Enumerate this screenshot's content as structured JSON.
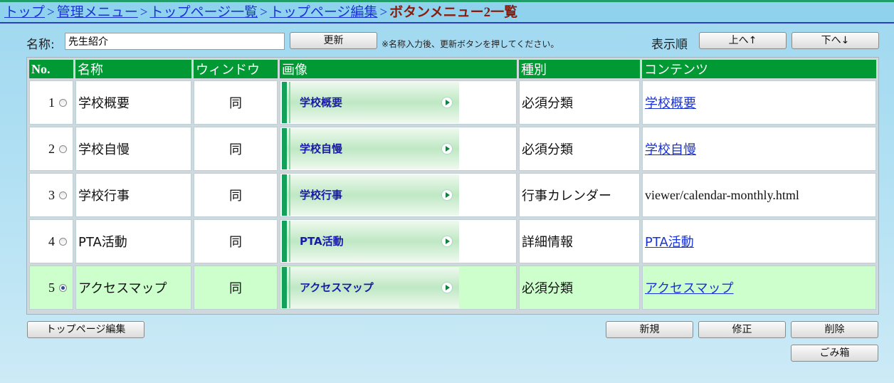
{
  "breadcrumb": {
    "items": [
      "トップ",
      "管理メニュー",
      "トップページ一覧",
      "トップページ編集"
    ],
    "separator": ">",
    "current": "ボタンメニュー2一覧"
  },
  "form": {
    "name_label": "名称:",
    "name_value": "先生紹介",
    "update_label": "更新",
    "note": "※名称入力後、更新ボタンを押してください。",
    "order_label": "表示順",
    "up_label": "上へ↑",
    "down_label": "下へ↓"
  },
  "table": {
    "headers": [
      "No.",
      "名称",
      "ウィンドウ",
      "画像",
      "種別",
      "コンテンツ"
    ],
    "rows": [
      {
        "no": "1",
        "name": "学校概要",
        "window": "同",
        "image_text": "学校概要",
        "type": "必須分類",
        "content": "学校概要",
        "link": true,
        "selected": false
      },
      {
        "no": "2",
        "name": "学校自慢",
        "window": "同",
        "image_text": "学校自慢",
        "type": "必須分類",
        "content": "学校自慢",
        "link": true,
        "selected": false
      },
      {
        "no": "3",
        "name": "学校行事",
        "window": "同",
        "image_text": "学校行事",
        "type": "行事カレンダー",
        "content": "viewer/calendar-monthly.html",
        "link": false,
        "selected": false
      },
      {
        "no": "4",
        "name": "PTA活動",
        "window": "同",
        "image_text": "PTA活動",
        "type": "詳細情報",
        "content": "PTA活動",
        "link": true,
        "selected": false
      },
      {
        "no": "5",
        "name": "アクセスマップ",
        "window": "同",
        "image_text": "アクセスマップ",
        "type": "必須分類",
        "content": "アクセスマップ",
        "link": true,
        "selected": true
      }
    ]
  },
  "buttons": {
    "top_edit": "トップページ編集",
    "new": "新規",
    "edit": "修正",
    "delete": "削除",
    "trash": "ごみ箱"
  },
  "colors": {
    "header_green": "#009933",
    "selected_row": "#ccffcc",
    "link_blue": "#1a33d6",
    "current_crumb": "#8a1c0c"
  }
}
